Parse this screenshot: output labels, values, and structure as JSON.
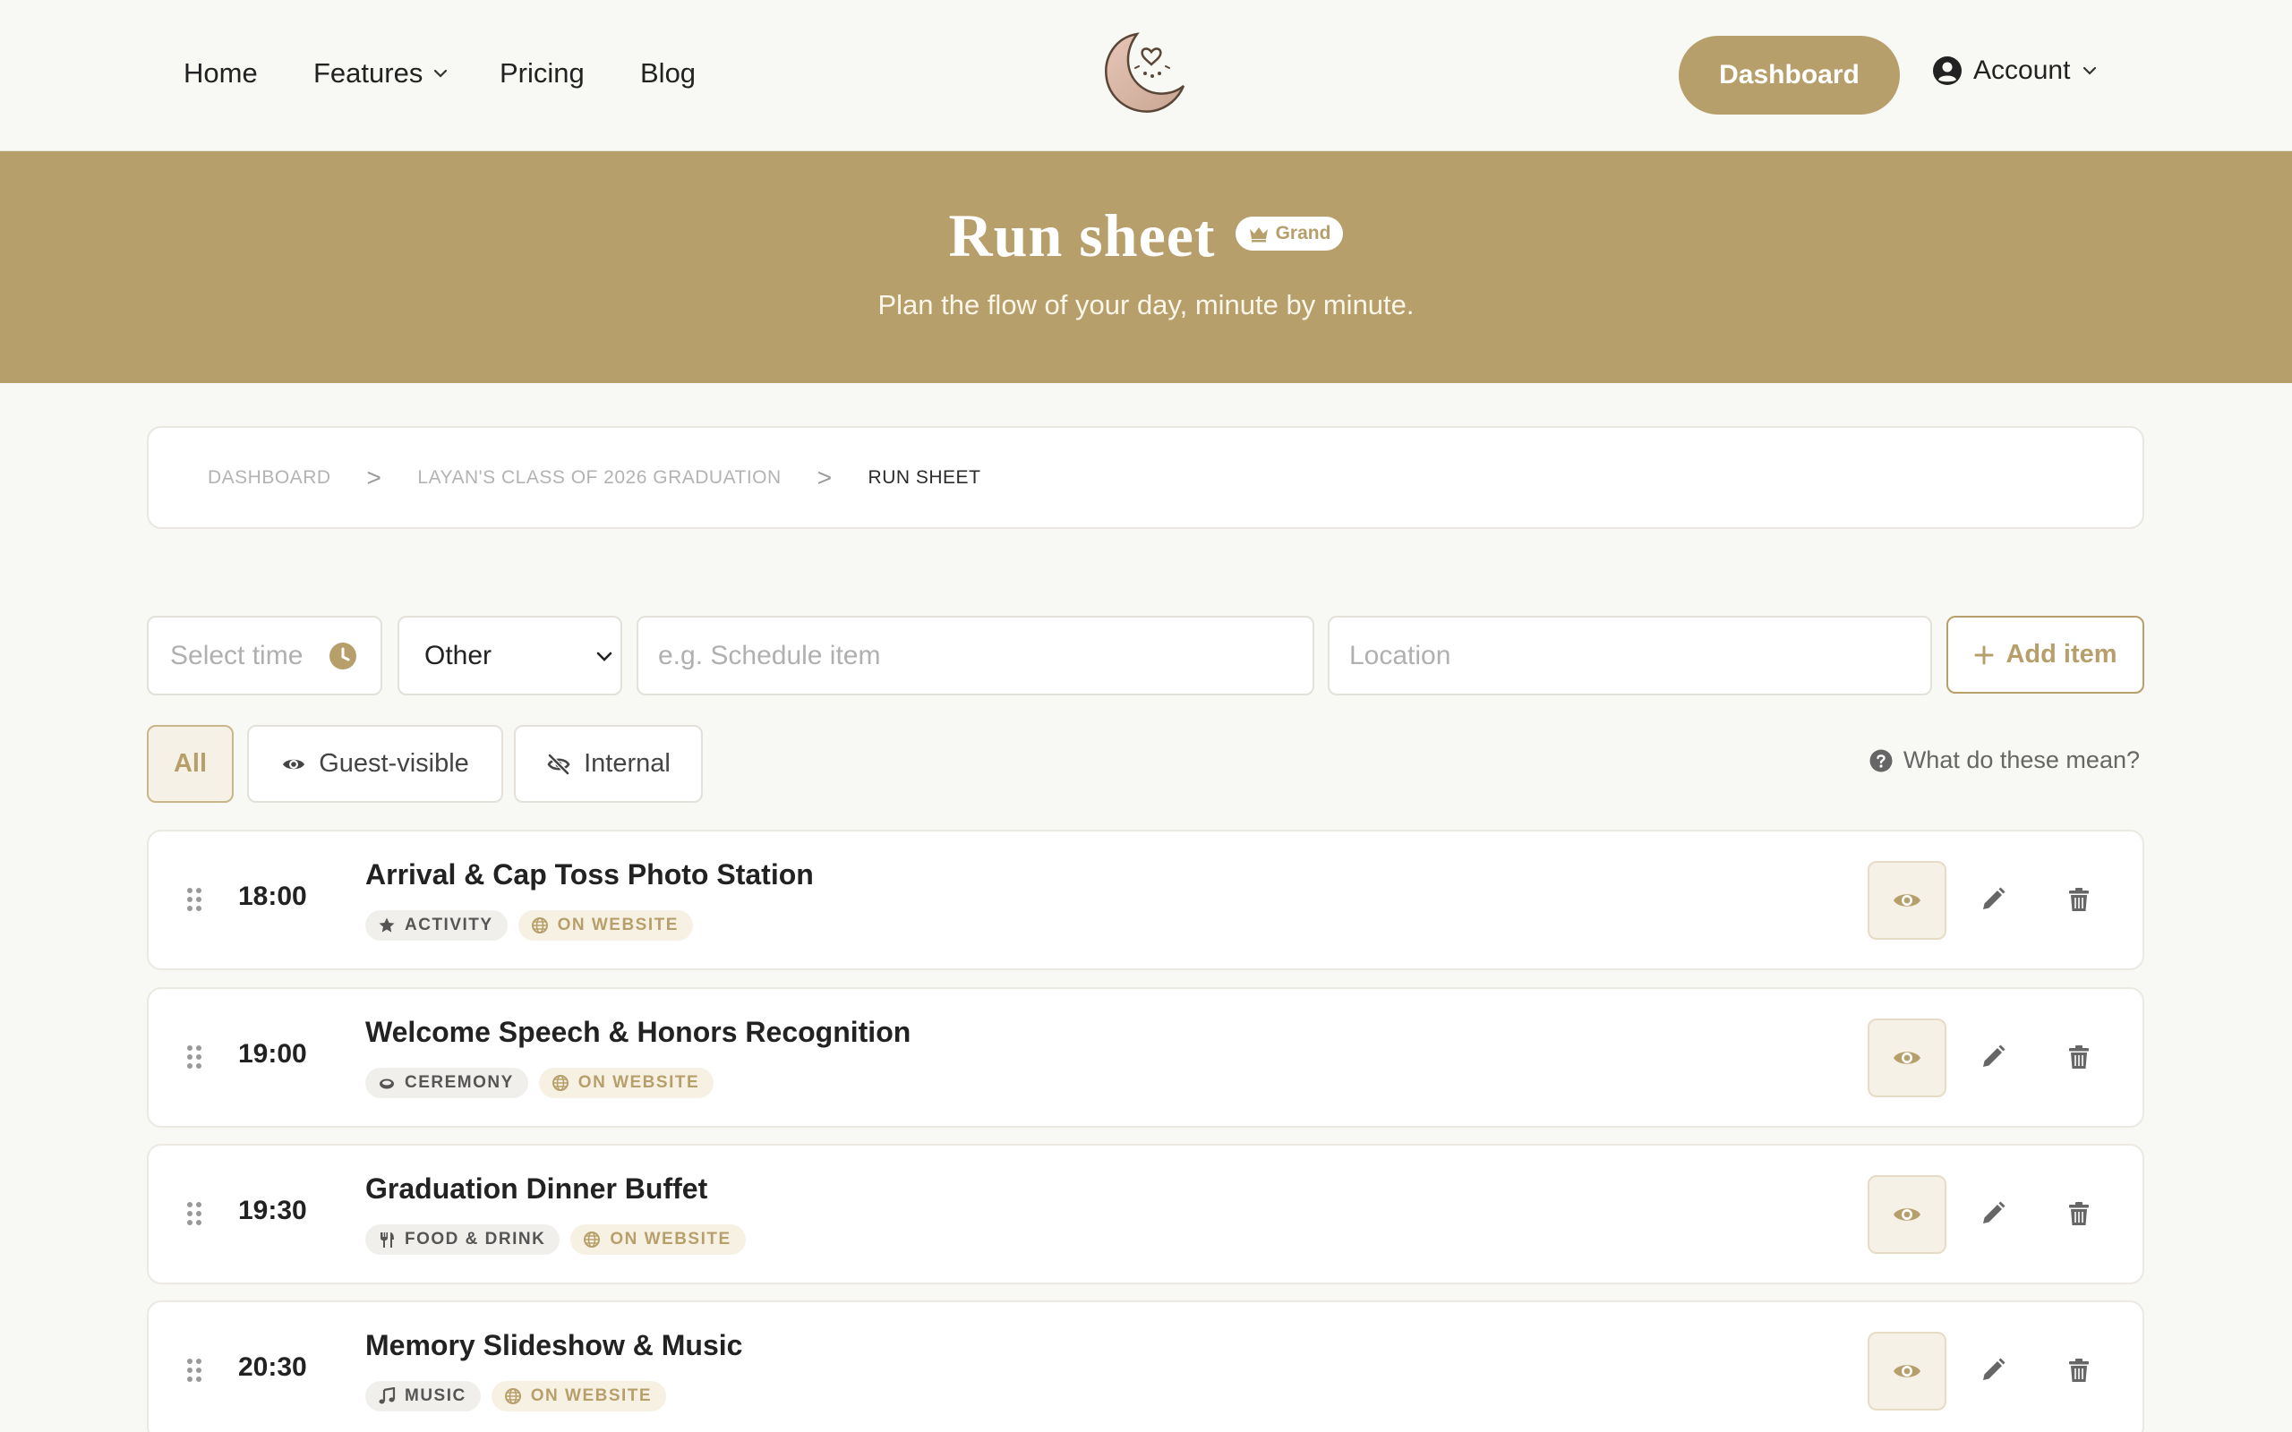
{
  "nav": {
    "links": [
      {
        "label": "Home"
      },
      {
        "label": "Features"
      },
      {
        "label": "Pricing"
      },
      {
        "label": "Blog"
      }
    ],
    "logo_icon": "moon-heart-logo",
    "dashboard_label": "Dashboard",
    "account_label": "Account"
  },
  "hero": {
    "title": "Run sheet",
    "badge": "Grand",
    "subtitle": "Plan the flow of your day, minute by minute."
  },
  "breadcrumb": {
    "items": [
      "DASHBOARD",
      "LAYAN'S CLASS OF 2026 GRADUATION",
      "RUN SHEET"
    ],
    "separator": ">"
  },
  "form": {
    "time_placeholder": "Select time",
    "category_value": "Other",
    "category_options": [
      "Other"
    ],
    "name_placeholder": "e.g. Schedule item",
    "location_placeholder": "Location",
    "add_label": "Add item"
  },
  "filters": {
    "all": "All",
    "guest": "Guest-visible",
    "internal": "Internal",
    "help": "What do these mean?"
  },
  "items": [
    {
      "time": "18:00",
      "title": "Arrival & Cap Toss Photo Station",
      "category": "ACTIVITY",
      "category_icon": "star-icon",
      "visibility": "ON WEBSITE"
    },
    {
      "time": "19:00",
      "title": "Welcome Speech & Honors Recognition",
      "category": "CEREMONY",
      "category_icon": "ring-icon",
      "visibility": "ON WEBSITE"
    },
    {
      "time": "19:30",
      "title": "Graduation Dinner Buffet",
      "category": "FOOD & DRINK",
      "category_icon": "utensils-icon",
      "visibility": "ON WEBSITE"
    },
    {
      "time": "20:30",
      "title": "Memory Slideshow & Music",
      "category": "MUSIC",
      "category_icon": "music-icon",
      "visibility": "ON WEBSITE"
    }
  ],
  "colors": {
    "accent": "#b79f6b",
    "background": "#f8f8f4"
  }
}
